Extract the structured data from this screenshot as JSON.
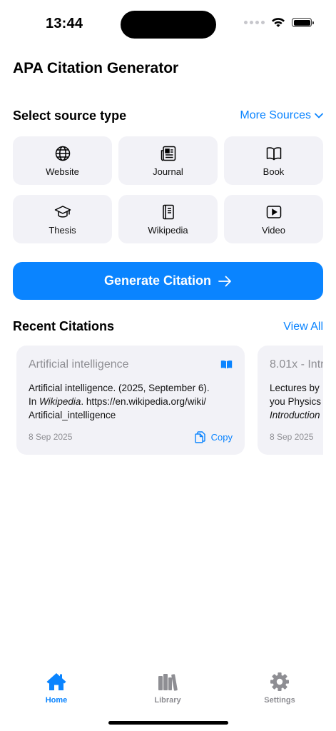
{
  "status_bar": {
    "time": "13:44"
  },
  "app": {
    "title": "APA Citation Generator"
  },
  "source_section": {
    "title": "Select source type",
    "more_label": "More Sources",
    "sources": [
      {
        "label": "Website",
        "icon": "globe-icon"
      },
      {
        "label": "Journal",
        "icon": "newspaper-icon"
      },
      {
        "label": "Book",
        "icon": "book-icon"
      },
      {
        "label": "Thesis",
        "icon": "graduation-cap-icon"
      },
      {
        "label": "Wikipedia",
        "icon": "wiki-book-icon"
      },
      {
        "label": "Video",
        "icon": "play-icon"
      }
    ]
  },
  "generate_button": {
    "label": "Generate Citation",
    "icon": "arrow-right-icon"
  },
  "recent": {
    "title": "Recent Citations",
    "view_all": "View All",
    "cards": [
      {
        "title": "Artificial intelligence",
        "line1": "Artificial intelligence. (2025, September 6).",
        "line2_prefix": "In ",
        "line2_italic": "Wikipedia",
        "line2_suffix": ". https://en.wikipedia.org/wiki/",
        "line3": "Artificial_intelligence",
        "date": "8 Sep 2025",
        "copy_label": "Copy"
      },
      {
        "title": "8.01x - Intr",
        "line1": "Lectures by",
        "line2_prefix": "you  Physics",
        "line3_italic": "Introduction",
        "date": "8 Sep 2025"
      }
    ]
  },
  "tabbar": {
    "tabs": [
      {
        "label": "Home",
        "icon": "house-icon"
      },
      {
        "label": "Library",
        "icon": "books-icon"
      },
      {
        "label": "Settings",
        "icon": "gear-icon"
      }
    ]
  },
  "colors": {
    "accent": "#0a84ff",
    "card_bg": "#f2f2f7",
    "muted": "#8e8e93"
  }
}
